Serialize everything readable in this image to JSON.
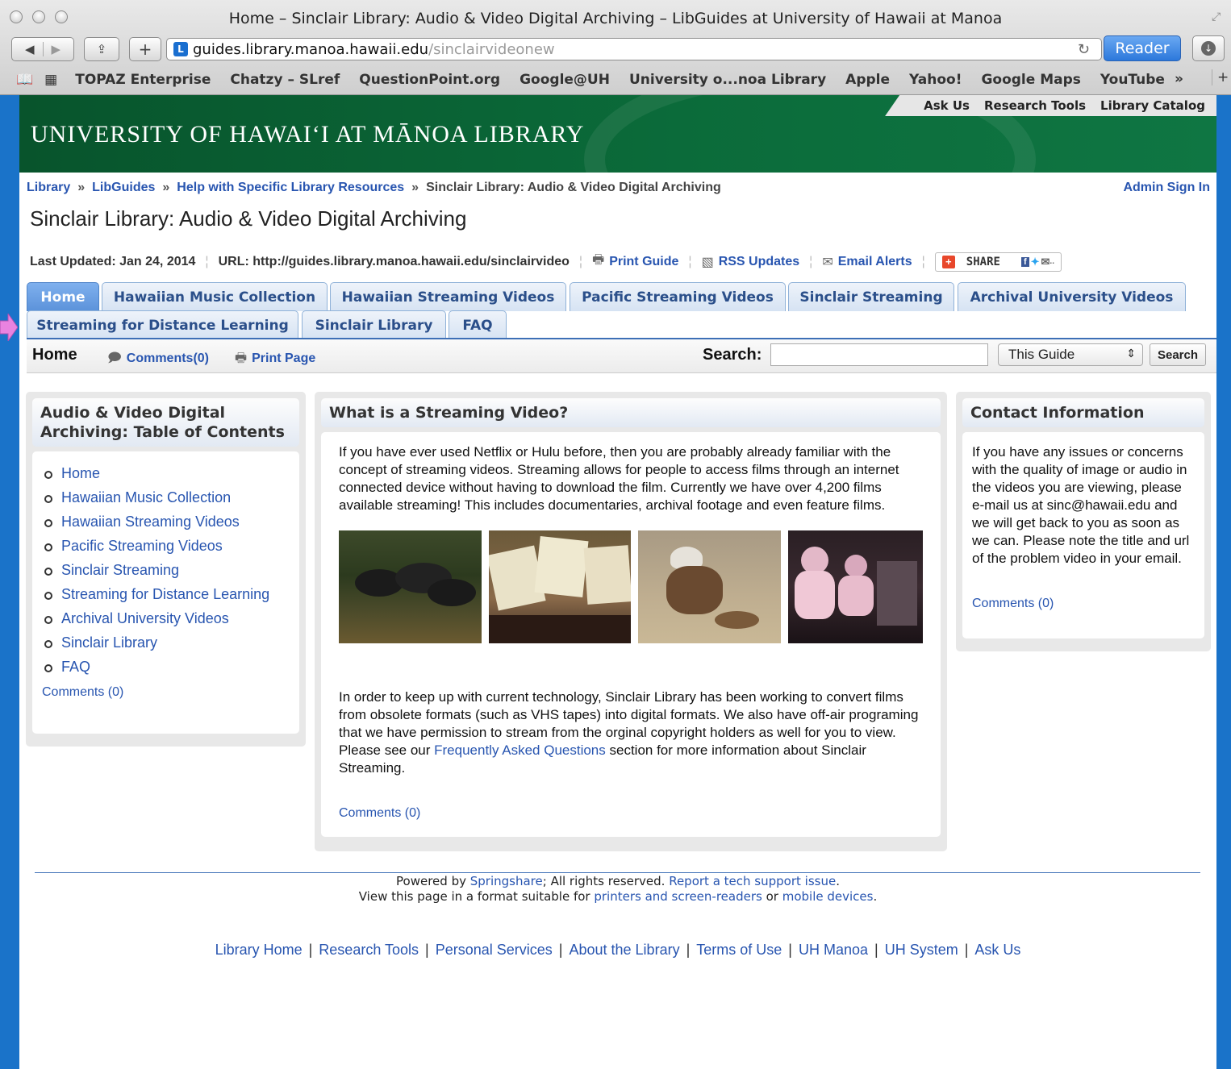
{
  "window": {
    "title": "Home – Sinclair Library: Audio & Video Digital Archiving – LibGuides at University of Hawaii at Manoa"
  },
  "toolbar": {
    "url_host": "guides.library.manoa.hawaii.edu",
    "url_path": "/sinclairvideonew",
    "reader_label": "Reader",
    "site_icon_letter": "L"
  },
  "bookmarks": [
    "TOPAZ Enterprise",
    "Chatzy – SLref",
    "QuestionPoint.org",
    "Google@UH",
    "University o...noa Library",
    "Apple",
    "Yahoo!",
    "Google Maps",
    "YouTube"
  ],
  "banner": {
    "title": "UNIVERSITY OF HAWAI‘I AT MĀNOA LIBRARY",
    "top_links": [
      "Ask Us",
      "Research Tools",
      "Library Catalog"
    ]
  },
  "breadcrumb": {
    "items": [
      "Library",
      "LibGuides",
      "Help with Specific Library Resources",
      "Sinclair Library: Audio & Video Digital Archiving"
    ],
    "separator": "»",
    "admin": "Admin Sign In"
  },
  "guide": {
    "title": "Sinclair Library: Audio & Video Digital Archiving",
    "last_updated": "Last Updated: Jan 24, 2014",
    "url": "URL: http://guides.library.manoa.hawaii.edu/sinclairvideo",
    "print": "Print Guide",
    "rss": "RSS Updates",
    "email": "Email Alerts",
    "share": "SHARE"
  },
  "tabs": {
    "row1": [
      "Home",
      "Hawaiian Music Collection",
      "Hawaiian Streaming Videos",
      "Pacific Streaming Videos",
      "Sinclair Streaming",
      "Archival University Videos"
    ],
    "row2": [
      "Streaming for Distance Learning",
      "Sinclair Library",
      "FAQ"
    ]
  },
  "subbar": {
    "page": "Home",
    "comments": "Comments(0)",
    "print": "Print Page",
    "search_label": "Search:",
    "scope": "This Guide",
    "search_button": "Search"
  },
  "toc": {
    "title": "Audio & Video Digital Archiving: Table of Contents",
    "items": [
      "Home",
      "Hawaiian Music Collection",
      "Hawaiian Streaming Videos",
      "Pacific Streaming Videos",
      "Sinclair Streaming",
      "Streaming for Distance Learning",
      "Archival University Videos",
      "Sinclair Library",
      "FAQ"
    ],
    "comments": "Comments (0)"
  },
  "main": {
    "title": "What is a Streaming Video?",
    "para1": "If you have ever used Netflix or Hulu before, then you are probably already familiar with the concept of streaming videos. Streaming allows for people to access films through an internet connected device without having to download the film. Currently we have over 4,200 films available streaming! This includes documentaries, archival footage and even feature films.",
    "para2_a": "In order to keep up with current technology, Sinclair Library has been working to convert films from obsolete formats (such as VHS tapes) into digital formats. We also have off-air programing that we have permission to stream from the orginal copyright holders as well for you to view. Please see our ",
    "para2_link": "Frequently Asked Questions",
    "para2_b": " section for more information about Sinclair Streaming.",
    "comments": "Comments (0)"
  },
  "contact": {
    "title": "Contact Information",
    "body": "If you have any issues or concerns with the quality of image or audio in the videos you are viewing, please e-mail us at sinc@hawaii.edu and we will get back to you as soon as we can. Please note the title and url of the problem video in your email.",
    "comments": "Comments (0)"
  },
  "footer": {
    "powered_a": "Powered by ",
    "springshare": "Springshare",
    "powered_b": "; All rights reserved. ",
    "report": "Report a tech support issue",
    "period": ".",
    "view_a": "View this page in a format suitable for ",
    "printers": "printers and screen-readers",
    "or": " or ",
    "mobile": "mobile devices",
    "links": [
      "Library Home",
      "Research Tools",
      "Personal Services",
      "About the Library",
      "Terms of Use",
      "UH Manoa",
      "UH System",
      "Ask Us"
    ]
  }
}
